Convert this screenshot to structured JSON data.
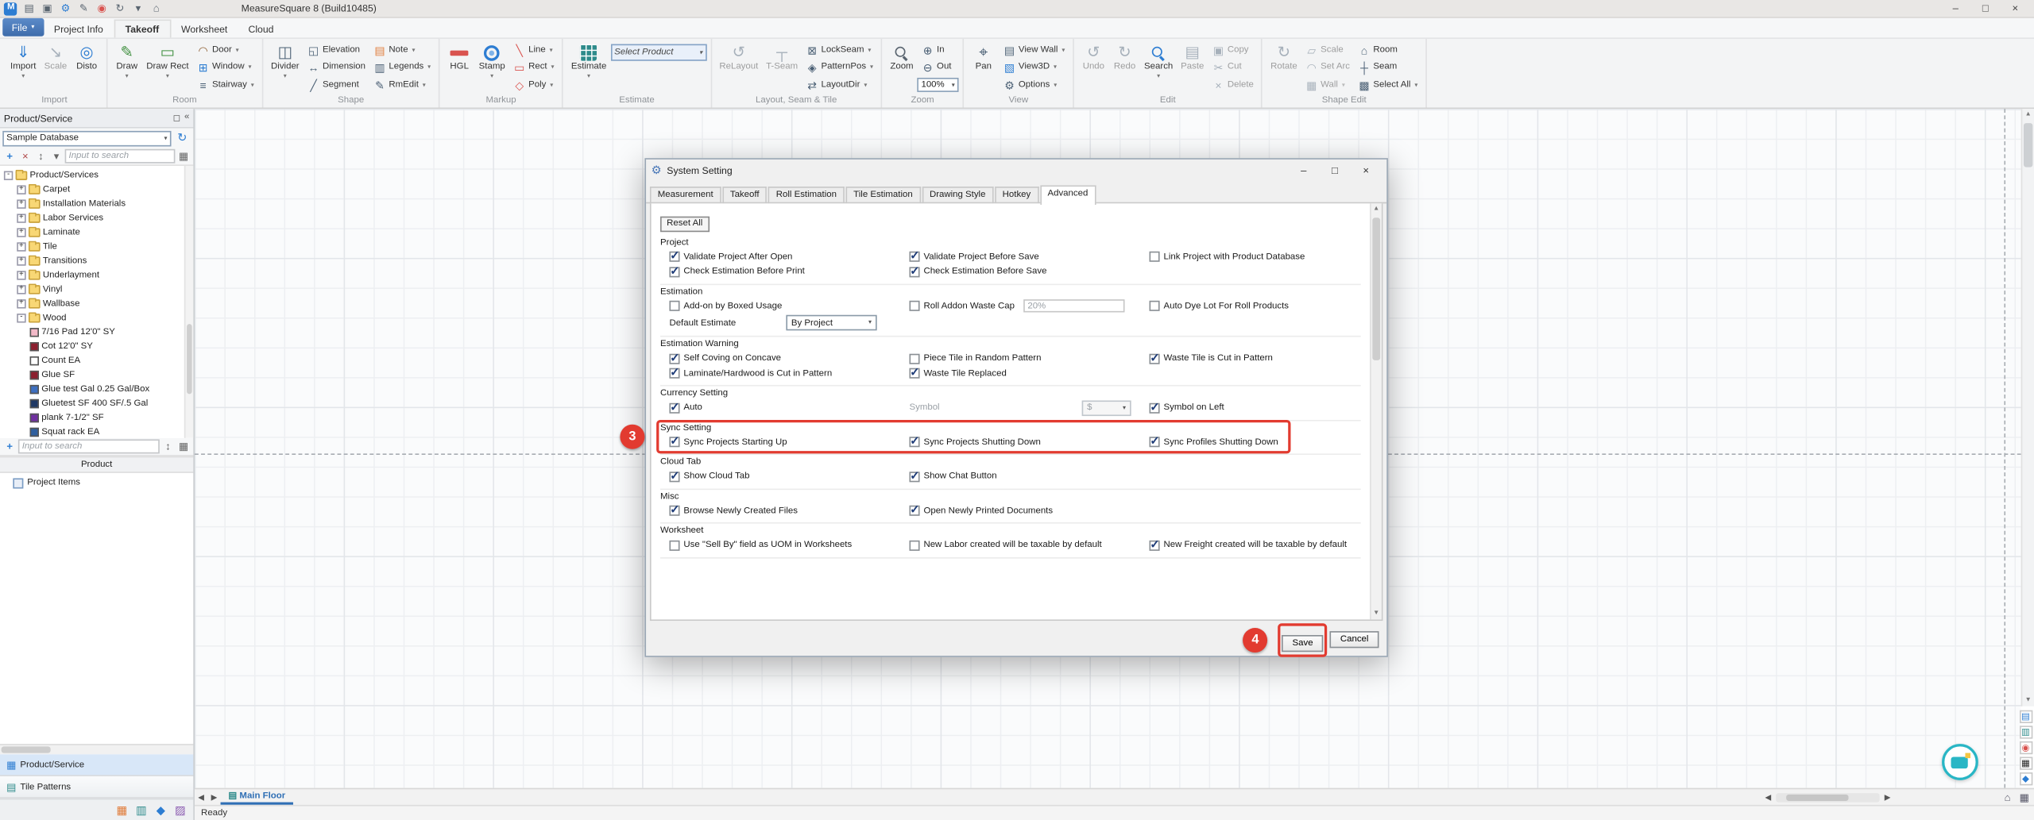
{
  "window": {
    "title": "MeasureSquare 8 (Build10485)"
  },
  "menubar": {
    "file": "File",
    "tabs": [
      "Project Info",
      "Takeoff",
      "Worksheet",
      "Cloud"
    ]
  },
  "ribbon": {
    "import_group": {
      "label": "Import",
      "import": "Import",
      "scale": "Scale",
      "disto": "Disto"
    },
    "room_group": {
      "label": "Room",
      "draw": "Draw",
      "draw_rect": "Draw Rect",
      "door": "Door",
      "window": "Window",
      "stairway": "Stairway"
    },
    "shape_group": {
      "label": "Shape",
      "divider": "Divider",
      "elevation": "Elevation",
      "dimension": "Dimension",
      "segment": "Segment",
      "note": "Note",
      "legends": "Legends",
      "rmedit": "RmEdit"
    },
    "markup_group": {
      "label": "Markup",
      "hgl": "HGL",
      "stamp": "Stamp",
      "line": "Line",
      "rect": "Rect",
      "poly": "Poly"
    },
    "estimate_group": {
      "label": "Estimate",
      "estimate": "Estimate",
      "select_product": "Select Product"
    },
    "layout_group": {
      "label": "Layout, Seam & Tile",
      "relayout": "ReLayout",
      "tseam": "T-Seam",
      "lockseam": "LockSeam",
      "patternpos": "PatternPos",
      "layoutdir": "LayoutDir"
    },
    "zoom_group": {
      "label": "Zoom",
      "zoom": "Zoom",
      "zoom_in": "In",
      "zoom_out": "Out",
      "zoom_level": "100%"
    },
    "view_group": {
      "label": "View",
      "pan": "Pan",
      "view_wall": "View Wall",
      "view3d": "View3D",
      "options": "Options"
    },
    "edit_group": {
      "label": "Edit",
      "undo": "Undo",
      "redo": "Redo",
      "search": "Search",
      "paste": "Paste",
      "copy": "Copy",
      "cut": "Cut",
      "delete": "Delete"
    },
    "shape_edit_group": {
      "label": "Shape Edit",
      "rotate": "Rotate",
      "scale": "Scale",
      "set_arc": "Set Arc",
      "wall": "Wall",
      "room": "Room",
      "seam": "Seam",
      "select_all": "Select All"
    }
  },
  "product_panel": {
    "title": "Product/Service",
    "database": "Sample Database",
    "search_placeholder": "Input to search",
    "tree": [
      {
        "label": "Product/Services",
        "cls": "lvl0 folder",
        "exp": "-"
      },
      {
        "label": "Carpet",
        "cls": "lvl1 folder",
        "exp": "+"
      },
      {
        "label": "Installation Materials",
        "cls": "lvl1 folder",
        "exp": "+"
      },
      {
        "label": "Labor Services",
        "cls": "lvl1 folder",
        "exp": "+"
      },
      {
        "label": "Laminate",
        "cls": "lvl1 folder",
        "exp": "+"
      },
      {
        "label": "Tile",
        "cls": "lvl1 folder",
        "exp": "+"
      },
      {
        "label": "Transitions",
        "cls": "lvl1 folder",
        "exp": "+"
      },
      {
        "label": "Underlayment",
        "cls": "lvl1 folder",
        "exp": "+"
      },
      {
        "label": "Vinyl",
        "cls": "lvl1 folder",
        "exp": "+"
      },
      {
        "label": "Wallbase",
        "cls": "lvl1 folder",
        "exp": "+"
      },
      {
        "label": "Wood",
        "cls": "lvl1 folder",
        "exp": "-"
      },
      {
        "label": "7/16 Pad 12'0\" SY",
        "cls": "lvl2 item",
        "exp": "",
        "swatch": "#f2b9c8"
      },
      {
        "label": "Cot 12'0\" SY",
        "cls": "lvl2 item",
        "exp": "",
        "swatch": "#8c1f2f"
      },
      {
        "label": "Count EA",
        "cls": "lvl2 item",
        "exp": "",
        "swatch": "#ffffff"
      },
      {
        "label": "Glue SF",
        "cls": "lvl2 item",
        "exp": "",
        "swatch": "#8c1f2f"
      },
      {
        "label": "Glue test Gal 0.25 Gal/Box",
        "cls": "lvl2 item",
        "exp": "",
        "swatch": "#3d6fc0"
      },
      {
        "label": "Gluetest SF 400 SF/.5 Gal",
        "cls": "lvl2 item",
        "exp": "",
        "swatch": "#1f3864"
      },
      {
        "label": "plank 7-1/2\" SF",
        "cls": "lvl2 item",
        "exp": "",
        "swatch": "#7030a0"
      },
      {
        "label": "Squat rack EA",
        "cls": "lvl2 item",
        "exp": "",
        "swatch": "#2e5e9e"
      }
    ]
  },
  "items_panel": {
    "title": "Product",
    "search_placeholder": "Input to search",
    "project_items": "Project Items"
  },
  "dock_tabs": {
    "product_service": "Product/Service",
    "tile_patterns": "Tile Patterns"
  },
  "floor_bar": {
    "main_floor": "Main Floor"
  },
  "statusbar": {
    "ready": "Ready"
  },
  "dialog": {
    "title": "System Setting",
    "tabs": [
      "Measurement",
      "Takeoff",
      "Roll Estimation",
      "Tile Estimation",
      "Drawing Style",
      "Hotkey",
      "Advanced"
    ],
    "reset_all": "Reset All",
    "project": {
      "title": "Project",
      "checks": [
        {
          "label": "Validate Project After Open",
          "state": "checked"
        },
        {
          "label": "Validate Project Before Save",
          "state": "checked"
        },
        {
          "label": "Link Project with Product Database",
          "state": "unchecked"
        },
        {
          "label": "Check Estimation Before Print",
          "state": "checked"
        },
        {
          "label": "Check Estimation Before Save",
          "state": "checked"
        }
      ]
    },
    "estimation": {
      "title": "Estimation",
      "addon_label": "Add-on by Boxed Usage",
      "addon_state": "unchecked",
      "waste_cap_label": "Roll Addon Waste Cap",
      "waste_cap_state": "unchecked",
      "waste_cap_value": "20%",
      "dye_lot_label": "Auto Dye Lot For Roll Products",
      "dye_lot_state": "unchecked",
      "default_estimate_label": "Default Estimate",
      "default_estimate_value": "By Project"
    },
    "estimation_warning": {
      "title": "Estimation Warning",
      "checks": [
        {
          "label": "Self Coving on Concave",
          "state": "checked"
        },
        {
          "label": "Piece Tile in Random Pattern",
          "state": "unchecked"
        },
        {
          "label": "Waste Tile is Cut in Pattern",
          "state": "checked"
        },
        {
          "label": "Laminate/Hardwood is Cut in Pattern",
          "state": "checked"
        },
        {
          "label": "Waste Tile Replaced",
          "state": "checked"
        }
      ]
    },
    "currency": {
      "title": "Currency Setting",
      "auto_label": "Auto",
      "auto_state": "checked",
      "symbol_label": "Symbol",
      "symbol_value": "$",
      "symbol_on_left_label": "Symbol on Left",
      "symbol_on_left_state": "checked"
    },
    "sync": {
      "title": "Sync Setting",
      "checks": [
        {
          "label": "Sync Projects Starting Up",
          "state": "checked"
        },
        {
          "label": "Sync Projects Shutting Down",
          "state": "checked"
        },
        {
          "label": "Sync Profiles Shutting Down",
          "state": "checked"
        }
      ]
    },
    "cloud": {
      "title": "Cloud Tab",
      "checks": [
        {
          "label": "Show Cloud Tab",
          "state": "checked"
        },
        {
          "label": "Show Chat Button",
          "state": "checked"
        }
      ]
    },
    "misc": {
      "title": "Misc",
      "checks": [
        {
          "label": "Browse Newly Created Files",
          "state": "checked"
        },
        {
          "label": "Open Newly Printed Documents",
          "state": "checked"
        }
      ]
    },
    "worksheet": {
      "title": "Worksheet",
      "checks": [
        {
          "label": "Use \"Sell By\" field as UOM in Worksheets",
          "state": "unchecked"
        },
        {
          "label": "New Labor created will be taxable by default",
          "state": "unchecked"
        },
        {
          "label": "New Freight created will be taxable by default",
          "state": "checked"
        }
      ]
    },
    "buttons": {
      "save": "Save",
      "cancel": "Cancel"
    }
  },
  "annotations": {
    "step3": "3",
    "step4": "4",
    "highlight_color": "#e23b30"
  }
}
